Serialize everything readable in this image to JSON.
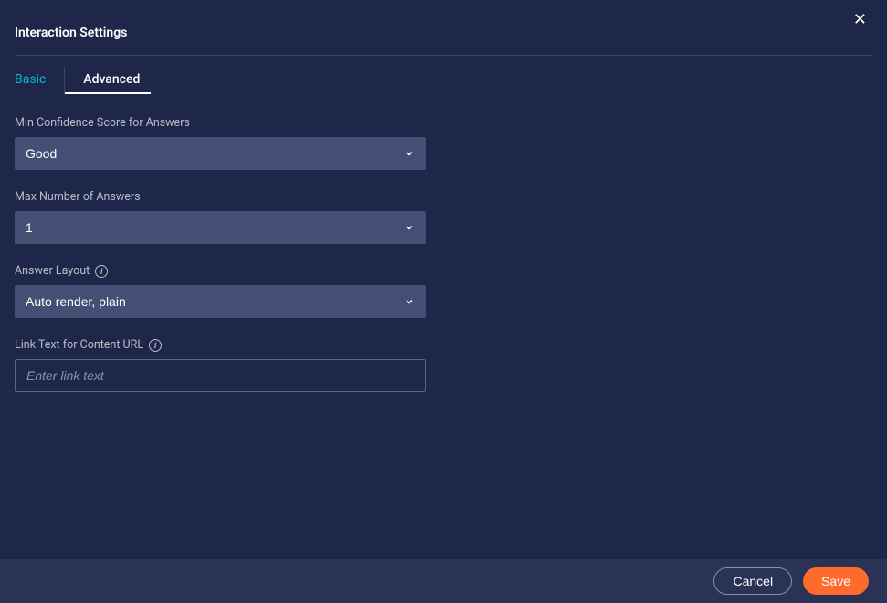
{
  "dialog": {
    "title": "Interaction Settings",
    "close_label": "✕"
  },
  "tabs": {
    "basic": "Basic",
    "advanced": "Advanced"
  },
  "fields": {
    "min_confidence": {
      "label": "Min Confidence Score for Answers",
      "value": "Good"
    },
    "max_answers": {
      "label": "Max Number of Answers",
      "value": "1"
    },
    "answer_layout": {
      "label": "Answer Layout",
      "value": "Auto render, plain"
    },
    "link_text": {
      "label": "Link Text for Content URL",
      "placeholder": "Enter link text",
      "value": ""
    }
  },
  "footer": {
    "cancel": "Cancel",
    "save": "Save"
  }
}
